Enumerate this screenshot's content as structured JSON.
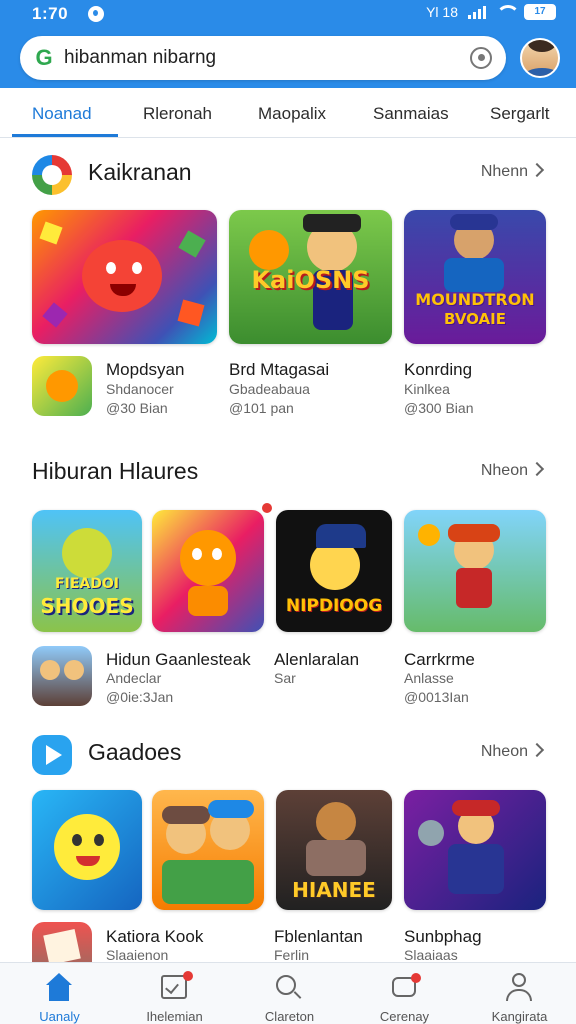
{
  "status_bar": {
    "time": "1:70",
    "extra": "Yl 18",
    "battery": "17"
  },
  "search": {
    "query": "hibanman nibarng"
  },
  "tabs": [
    {
      "label": "Noanad",
      "active": true
    },
    {
      "label": "Rleronah",
      "active": false
    },
    {
      "label": "Maopalix",
      "active": false
    },
    {
      "label": "Sanmaias",
      "active": false
    },
    {
      "label": "Sergarlt",
      "active": false
    }
  ],
  "sections": [
    {
      "title": "Kaikranan",
      "more": "Nhenn",
      "icon": "multicolor-app-icon",
      "tiles": [
        {
          "art": "MOUNDTRON",
          "art2": "BVOAIE"
        }
      ],
      "tile_text": {
        "t2": "KaiOSNS",
        "t3a": "MOUNDTRON",
        "t3b": "BVOAIE"
      },
      "apps": [
        {
          "name": "Mopdsyan",
          "sub": "Shdanocer",
          "size": "@30 Bian"
        },
        {
          "name": "Brd Mtagasai",
          "sub": "Gbadeabaua",
          "size": "@101 pan"
        },
        {
          "name": "Konrding",
          "sub": "Kinlkea",
          "size": "@300 Bian"
        }
      ]
    },
    {
      "title": "Hiburan Hlaures",
      "more": "Nheon",
      "tile_text": {
        "t1a": "FIEADOI",
        "t1b": "SHOOES",
        "t3": "NIPDIOOG"
      },
      "apps": [
        {
          "name": "Hidun Gaanlesteak",
          "sub": "Andeclar",
          "size": "@0ie:3Jan"
        },
        {
          "name": "Alenlaralan",
          "sub": "Sar",
          "size": ""
        },
        {
          "name": "Carrkrme",
          "sub": "Anlasse",
          "size": "@0013Ian"
        }
      ]
    },
    {
      "title": "Gaadoes",
      "more": "Nheon",
      "icon": "play-icon",
      "tile_text": {
        "t3": "HIANEE"
      },
      "apps": [
        {
          "name": "Katiora Kook",
          "sub": "Slaaienon",
          "size": ""
        },
        {
          "name": "Fblenlantan",
          "sub": "Ferlin",
          "size": ""
        },
        {
          "name": "Sunbphag",
          "sub": "Slaaiaas",
          "size": ""
        }
      ]
    }
  ],
  "bottom_nav": [
    {
      "label": "Uanaly",
      "icon": "home-icon",
      "active": true
    },
    {
      "label": "Ihelemian",
      "icon": "checklist-icon",
      "active": false
    },
    {
      "label": "Clareton",
      "icon": "search-icon",
      "active": false
    },
    {
      "label": "Cerenay",
      "icon": "chat-icon",
      "active": false
    },
    {
      "label": "Kangirata",
      "icon": "profile-icon",
      "active": false
    }
  ],
  "colors": {
    "accent": "#1e7ad8",
    "top_bar": "#2a8be8",
    "badge": "#e53935"
  }
}
